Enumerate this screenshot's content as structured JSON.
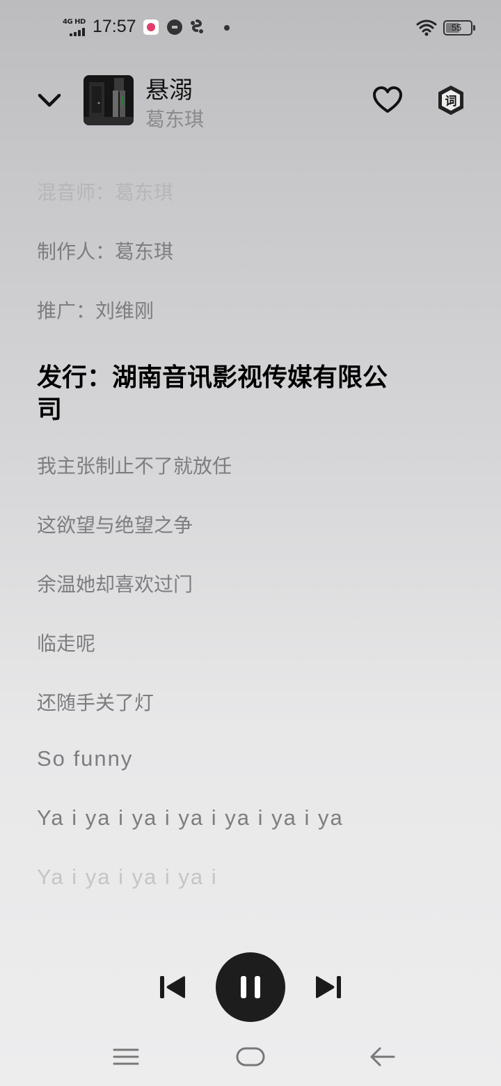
{
  "status_bar": {
    "network": "4G HD",
    "time": "17:57",
    "battery": "55",
    "battery_level": 0.55
  },
  "header": {
    "song_title": "悬溺",
    "artist": "葛东琪",
    "lyric_badge": "词"
  },
  "lyrics": {
    "lines": [
      "混音师：葛东琪",
      "制作人：葛东琪",
      "推广：刘维刚",
      "发行：湖南音讯影视传媒有限公司",
      "我主张制止不了就放任",
      "这欲望与绝望之争",
      "余温她却喜欢过门",
      "临走呢",
      "还随手关了灯",
      "So funny",
      "Ya i ya i ya i ya i ya i ya i ya",
      "Ya i ya i ya i ya i"
    ],
    "current_index": 3
  },
  "playback": {
    "state": "playing"
  }
}
